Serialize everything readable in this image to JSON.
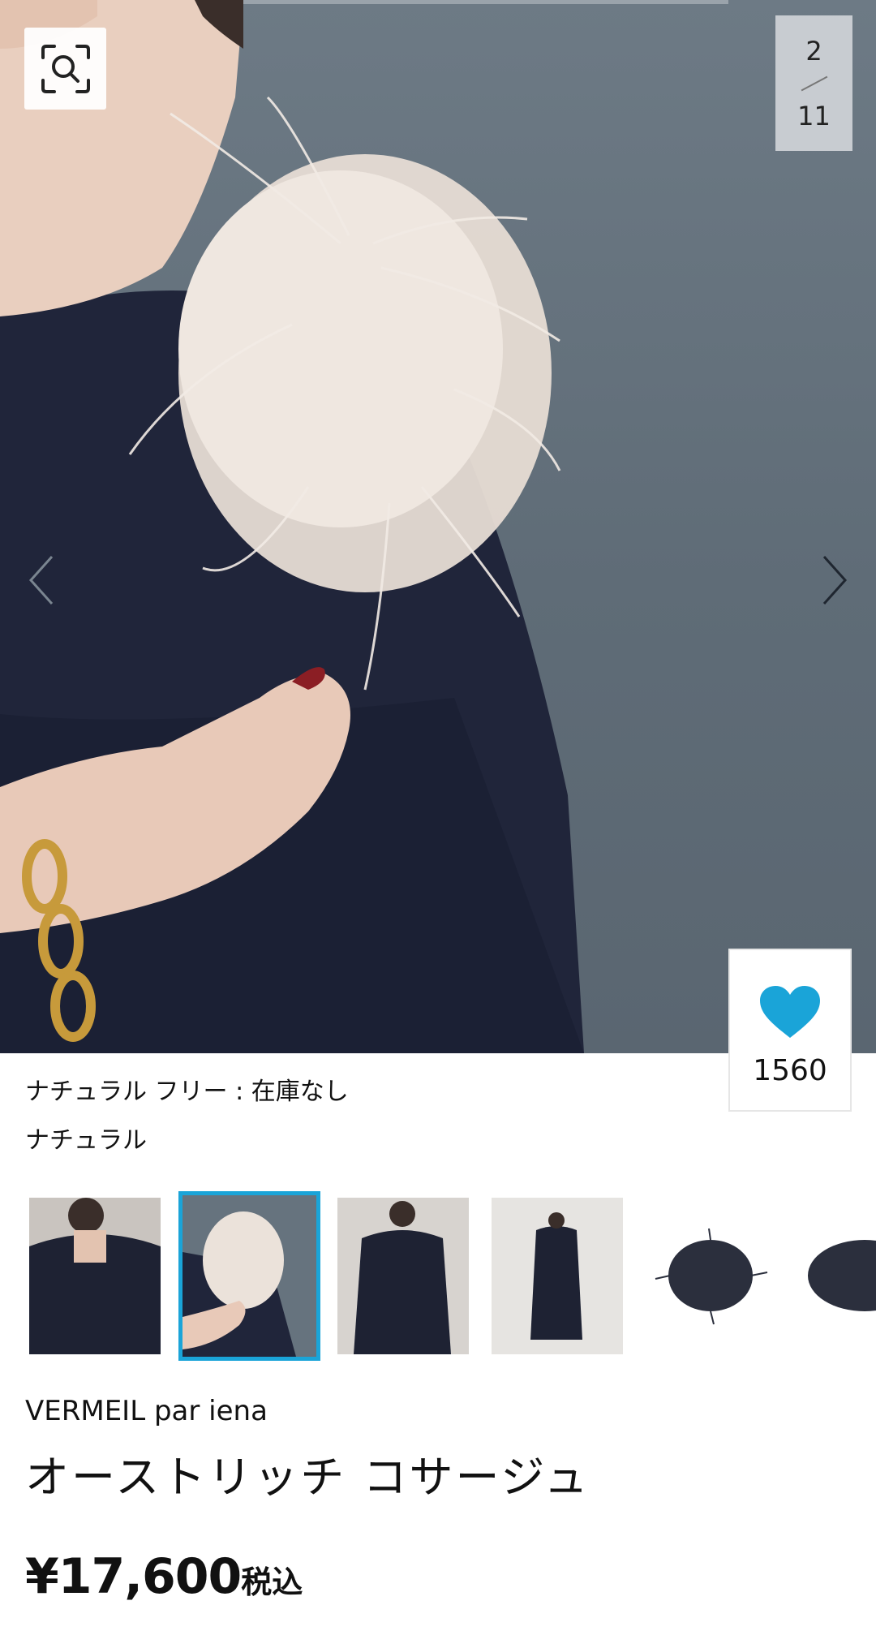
{
  "gallery": {
    "current": "2",
    "total": "11",
    "favorite_count": "1560",
    "zoom_icon": "zoom-search-icon",
    "prev_icon": "chevron-left-icon",
    "next_icon": "chevron-right-icon",
    "heart_icon": "heart-icon",
    "heart_color": "#1aa4d8"
  },
  "variant": {
    "stock_line": "ナチュラル フリー : 在庫なし",
    "color_name": "ナチュラル"
  },
  "thumbnails": {
    "selected_index": 1,
    "accent_color": "#1aa4d8"
  },
  "product": {
    "brand": "VERMEIL par iena",
    "name": "オーストリッチ コサージュ",
    "price": "¥17,600",
    "tax_label": "税込"
  }
}
